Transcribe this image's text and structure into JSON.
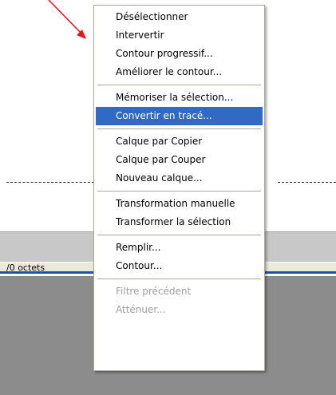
{
  "status": {
    "text": "/0 octets"
  },
  "context_menu": {
    "groups": [
      [
        {
          "label": "Désélectionner"
        },
        {
          "label": "Intervertir"
        },
        {
          "label": "Contour progressif..."
        },
        {
          "label": "Améliorer le contour..."
        }
      ],
      [
        {
          "label": "Mémoriser la sélection..."
        },
        {
          "label": "Convertir en tracé...",
          "state": "highlighted"
        }
      ],
      [
        {
          "label": "Calque par Copier"
        },
        {
          "label": "Calque par Couper"
        },
        {
          "label": "Nouveau calque..."
        }
      ],
      [
        {
          "label": "Transformation manuelle"
        },
        {
          "label": "Transformer la sélection"
        }
      ],
      [
        {
          "label": "Remplir..."
        },
        {
          "label": "Contour..."
        }
      ],
      [
        {
          "label": "Filtre précédent",
          "state": "disabled"
        },
        {
          "label": "Atténuer...",
          "state": "disabled"
        }
      ]
    ]
  },
  "colors": {
    "highlight": "#316ac5",
    "arrow": "#e8141c",
    "status_border": "#1f4fb6",
    "workspace_gray": "#8c8c8c"
  },
  "icons": {
    "pointer_arrow": "red-arrow-icon"
  }
}
